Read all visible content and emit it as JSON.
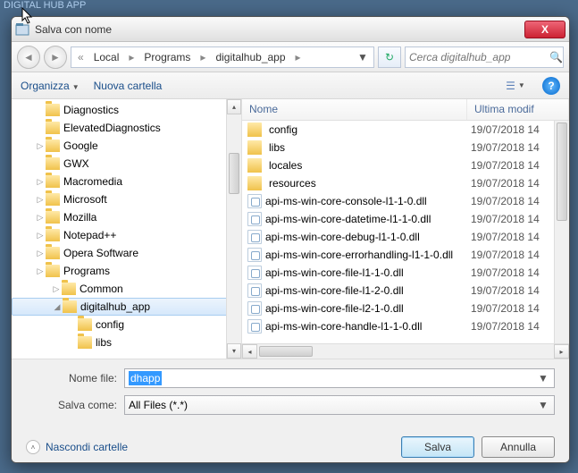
{
  "title_remnant": "DIGITAL HUB APP",
  "dialog_title": "Salva con nome",
  "breadcrumb": {
    "sep": "«",
    "items": [
      "Local",
      "Programs",
      "digitalhub_app"
    ]
  },
  "search": {
    "placeholder": "Cerca digitalhub_app"
  },
  "toolbar": {
    "organize": "Organizza",
    "new_folder": "Nuova cartella"
  },
  "tree": [
    {
      "indent": 1,
      "label": "Diagnostics",
      "tw": ""
    },
    {
      "indent": 1,
      "label": "ElevatedDiagnostics",
      "tw": ""
    },
    {
      "indent": 1,
      "label": "Google",
      "tw": "▷"
    },
    {
      "indent": 1,
      "label": "GWX",
      "tw": ""
    },
    {
      "indent": 1,
      "label": "Macromedia",
      "tw": "▷"
    },
    {
      "indent": 1,
      "label": "Microsoft",
      "tw": "▷"
    },
    {
      "indent": 1,
      "label": "Mozilla",
      "tw": "▷"
    },
    {
      "indent": 1,
      "label": "Notepad++",
      "tw": "▷"
    },
    {
      "indent": 1,
      "label": "Opera Software",
      "tw": "▷"
    },
    {
      "indent": 1,
      "label": "Programs",
      "tw": "▷"
    },
    {
      "indent": 2,
      "label": "Common",
      "tw": "▷"
    },
    {
      "indent": 2,
      "label": "digitalhub_app",
      "tw": "◢",
      "sel": true
    },
    {
      "indent": 3,
      "label": "config",
      "tw": ""
    },
    {
      "indent": 3,
      "label": "libs",
      "tw": ""
    }
  ],
  "columns": {
    "name": "Nome",
    "date": "Ultima modif"
  },
  "files": [
    {
      "type": "folder",
      "name": "config",
      "date": "19/07/2018 14"
    },
    {
      "type": "folder",
      "name": "libs",
      "date": "19/07/2018 14"
    },
    {
      "type": "folder",
      "name": "locales",
      "date": "19/07/2018 14"
    },
    {
      "type": "folder",
      "name": "resources",
      "date": "19/07/2018 14"
    },
    {
      "type": "dll",
      "name": "api-ms-win-core-console-l1-1-0.dll",
      "date": "19/07/2018 14"
    },
    {
      "type": "dll",
      "name": "api-ms-win-core-datetime-l1-1-0.dll",
      "date": "19/07/2018 14"
    },
    {
      "type": "dll",
      "name": "api-ms-win-core-debug-l1-1-0.dll",
      "date": "19/07/2018 14"
    },
    {
      "type": "dll",
      "name": "api-ms-win-core-errorhandling-l1-1-0.dll",
      "date": "19/07/2018 14"
    },
    {
      "type": "dll",
      "name": "api-ms-win-core-file-l1-1-0.dll",
      "date": "19/07/2018 14"
    },
    {
      "type": "dll",
      "name": "api-ms-win-core-file-l1-2-0.dll",
      "date": "19/07/2018 14"
    },
    {
      "type": "dll",
      "name": "api-ms-win-core-file-l2-1-0.dll",
      "date": "19/07/2018 14"
    },
    {
      "type": "dll",
      "name": "api-ms-win-core-handle-l1-1-0.dll",
      "date": "19/07/2018 14"
    }
  ],
  "form": {
    "filename_label": "Nome file:",
    "filename_value": "dhapp",
    "saveas_label": "Salva come:",
    "saveas_value": "All Files (*.*)"
  },
  "footer": {
    "hide_folders": "Nascondi cartelle",
    "save": "Salva",
    "cancel": "Annulla"
  },
  "glyphs": {
    "close": "X",
    "back": "◄",
    "fwd": "►",
    "dd": "▼",
    "refresh": "↻",
    "mag": "🔍",
    "chev_up": "˄",
    "help": "?",
    "tri_r": "▸",
    "tri_l": "◂"
  }
}
